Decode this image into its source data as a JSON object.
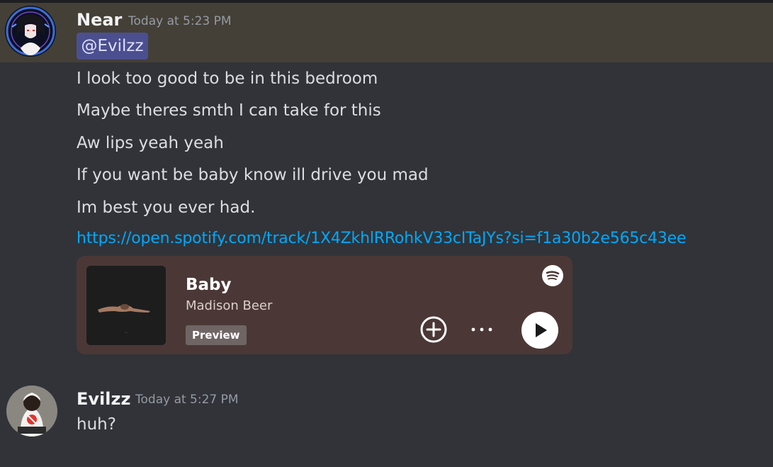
{
  "messages": [
    {
      "author": "Near",
      "timestamp": "Today at 5:23 PM",
      "mention": "@Evilzz",
      "lines": [
        "I look too good to be in this bedroom",
        "Maybe theres smth I can take for this",
        "Aw lips yeah yeah",
        "If you want be baby know ill drive you mad",
        "Im best you ever had."
      ],
      "link": "https://open.spotify.com/track/1X4ZkhlRRohkV33cITaJYs?si=f1a30b2e565c43ee",
      "embed": {
        "title": "Baby",
        "artist": "Madison Beer",
        "badge": "Preview",
        "provider_icon": "spotify-icon",
        "actions": [
          "add-icon",
          "more-icon",
          "play-icon"
        ]
      }
    },
    {
      "author": "Evilzz",
      "timestamp": "Today at 5:27 PM",
      "lines": [
        "huh?"
      ]
    }
  ],
  "colors": {
    "background": "#313338",
    "mention_highlight": "#444037",
    "mention_pill": "#4b4f8f",
    "link": "#00a8fc",
    "embed_background": "#4b3836"
  }
}
